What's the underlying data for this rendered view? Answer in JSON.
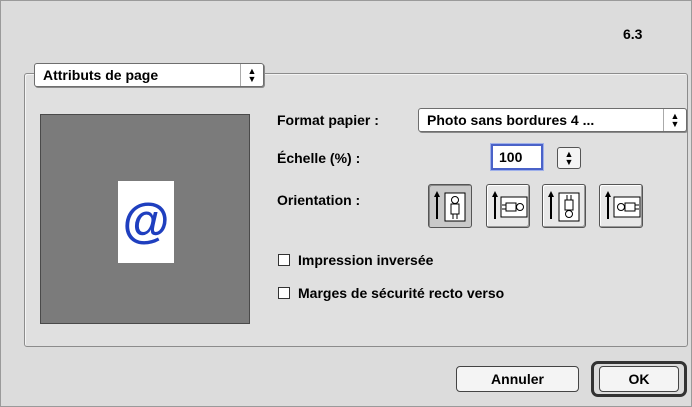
{
  "dialog": {
    "version": "6.3"
  },
  "page_select": {
    "value": "Attributs de page"
  },
  "paper": {
    "label": "Format papier :",
    "value": "Photo sans bordures 4 ..."
  },
  "scale": {
    "label": "Échelle (%) :",
    "value": "100"
  },
  "orientation": {
    "label": "Orientation :",
    "options": [
      {
        "name": "portrait",
        "selected": true
      },
      {
        "name": "landscape",
        "selected": false
      },
      {
        "name": "reverse-portrait",
        "selected": false
      },
      {
        "name": "reverse-landscape",
        "selected": false
      }
    ]
  },
  "options": {
    "invert_print": "Impression inversée",
    "duplex_margins": "Marges de sécurité recto verso"
  },
  "preview": {
    "glyph": "@",
    "glyph_color": "#1f3fbf"
  },
  "buttons": {
    "cancel": "Annuler",
    "ok": "OK"
  }
}
